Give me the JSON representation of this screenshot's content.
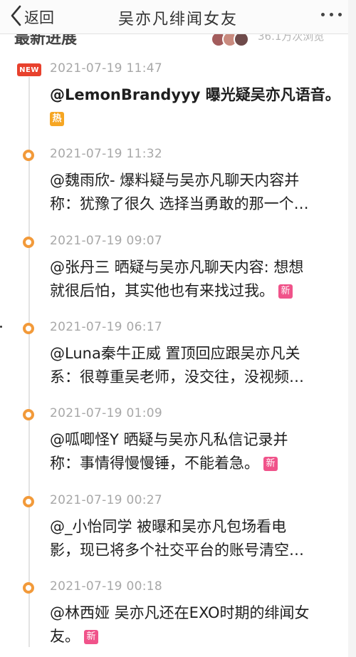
{
  "header": {
    "back_label": "返回",
    "title": "吴亦凡绯闻女友"
  },
  "subheader": {
    "left_text": "最新进展",
    "right_text": "36.1万次浏览",
    "avatar_colors": [
      "#a35c5c",
      "#c98a7e",
      "#6e4a4a"
    ]
  },
  "colors": {
    "accent_orange": "#f29a3a",
    "new_badge": "#e8412d",
    "hot_tag": "#f6a623",
    "new_tag": "#f0538a"
  },
  "items": [
    {
      "badge": "NEW",
      "time": "2021-07-19 11:47",
      "lines": [
        "@LemonBrandyyy 曝光疑吴亦凡语音。"
      ],
      "tag": "热"
    },
    {
      "time": "2021-07-19 11:32",
      "lines": [
        "@魏雨欣- 爆料疑与吴亦凡聊天内容并",
        "称：犹豫了很久 选择当勇敢的那一个…"
      ]
    },
    {
      "time": "2021-07-19 09:07",
      "lines": [
        "@张丹三 晒疑与吴亦凡聊天内容: 想想",
        "就很后怕，其实他也有来找过我。"
      ],
      "tag": "新"
    },
    {
      "time": "2021-07-19 06:17",
      "lines": [
        "@Luna秦牛正威 置顶回应跟吴亦凡关",
        "系：很尊重吴老师，没交往，没视频…"
      ]
    },
    {
      "time": "2021-07-19 01:09",
      "lines": [
        "@呱唧怪Y 晒疑与吴亦凡私信记录并",
        "称：事情得慢慢锤，不能着急。"
      ],
      "tag": "新"
    },
    {
      "time": "2021-07-19 00:27",
      "lines": [
        "@_小怡同学 被曝和吴亦凡包场看电",
        "影，现已将多个社交平台的账号清空…"
      ]
    },
    {
      "time": "2021-07-19 00:18",
      "lines": [
        "@林西娅 吴亦凡还在EXO时期的绯闻女",
        "友。"
      ],
      "tag": "新"
    }
  ]
}
